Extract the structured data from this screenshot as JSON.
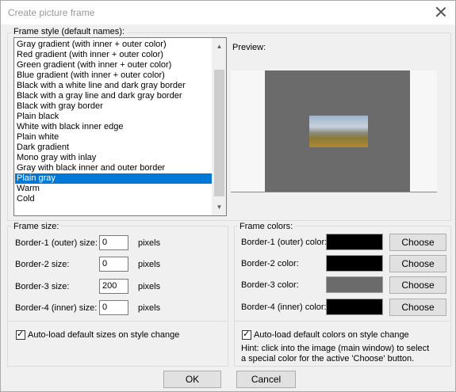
{
  "window": {
    "title": "Create picture frame"
  },
  "frame_style": {
    "label": "Frame style (default names):",
    "items": [
      "Gray gradient (with inner + outer color)",
      "Red gradient (with inner + outer color)",
      "Green gradient (with inner + outer color)",
      "Blue gradient (with inner + outer color)",
      "Black with a white line and dark gray border",
      "Black with a gray line and dark gray border",
      "Black with gray border",
      "Plain black",
      "White with black inner edge",
      "Plain white",
      "Dark gradient",
      "Mono gray with inlay",
      "Gray with black inner and outer border",
      "Plain gray",
      "Warm",
      "Cold"
    ],
    "selected_index": 13
  },
  "preview": {
    "label": "Preview:"
  },
  "frame_size": {
    "label": "Frame size:",
    "rows": [
      {
        "label": "Border-1 (outer) size:",
        "value": "0",
        "unit": "pixels"
      },
      {
        "label": "Border-2 size:",
        "value": "0",
        "unit": "pixels"
      },
      {
        "label": "Border-3 size:",
        "value": "200",
        "unit": "pixels"
      },
      {
        "label": "Border-4 (inner) size:",
        "value": "0",
        "unit": "pixels"
      }
    ],
    "autoload_label": "Auto-load default sizes on style change"
  },
  "frame_colors": {
    "label": "Frame colors:",
    "rows": [
      {
        "label": "Border-1 (outer) color:",
        "color": "#000000",
        "button": "Choose"
      },
      {
        "label": "Border-2 color:",
        "color": "#000000",
        "button": "Choose"
      },
      {
        "label": "Border-3 color:",
        "color": "#6b6b6b",
        "button": "Choose"
      },
      {
        "label": "Border-4 (inner) color:",
        "color": "#000000",
        "button": "Choose"
      }
    ],
    "autoload_label": "Auto-load default colors on style change",
    "hint": "Hint: click into the image (main window) to select a special color for the active 'Choose' button."
  },
  "buttons": {
    "ok": "OK",
    "cancel": "Cancel"
  }
}
